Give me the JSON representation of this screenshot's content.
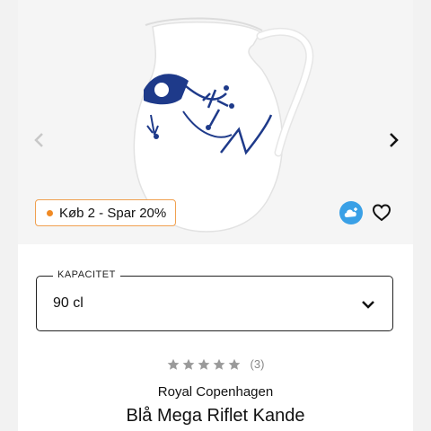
{
  "product_image": {
    "prev_icon": "chevron-left-icon",
    "next_icon": "chevron-right-icon",
    "promo_label": "Køb 2 - Spar 20%",
    "promo_color": "#f08a24",
    "cloud_icon": "cloud-plus-icon",
    "favorite_icon": "heart-outline-icon"
  },
  "capacity": {
    "label": "KAPACITET",
    "selected": "90 cl",
    "dropdown_icon": "chevron-down-icon"
  },
  "rating": {
    "stars": 0,
    "max_stars": 5,
    "count_label": "(3)"
  },
  "product": {
    "brand": "Royal Copenhagen",
    "title": "Blå Mega Riflet Kande"
  },
  "colors": {
    "pattern_blue": "#1e3a8a",
    "star_gray": "#9a9a9a",
    "cloud_blue": "#3aa0e6"
  }
}
